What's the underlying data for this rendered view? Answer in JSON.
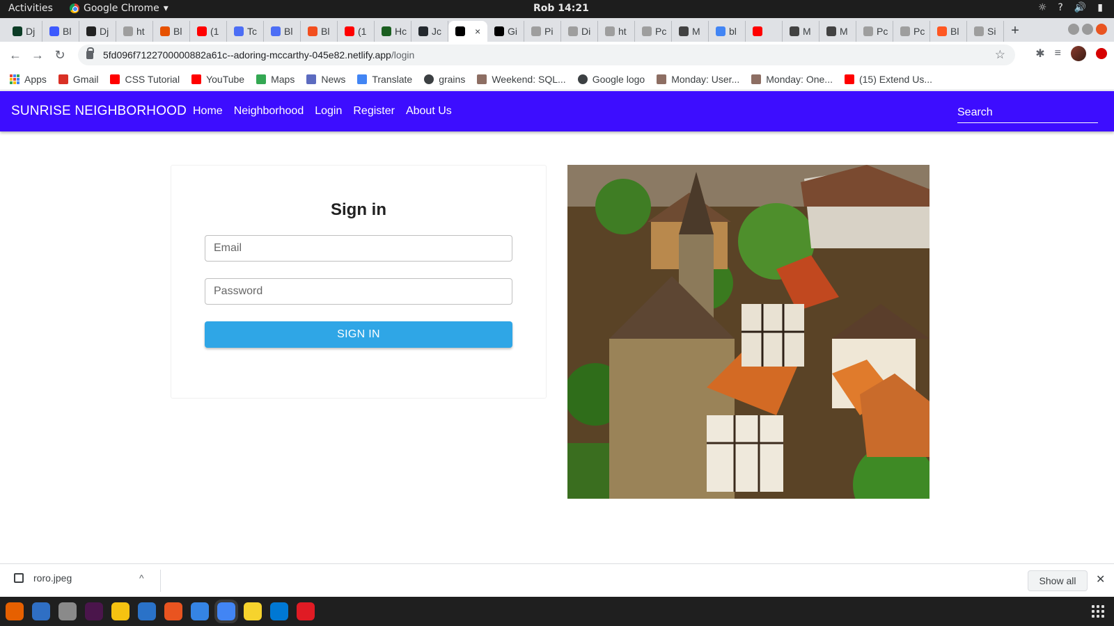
{
  "os": {
    "activities_label": "Activities",
    "app_name": "Google Chrome",
    "app_menu_arrow": "▾",
    "clock": "Rob 14:21",
    "tray_icons": [
      "weather-icon",
      "help-icon",
      "volume-icon",
      "battery-icon"
    ],
    "tray_glyphs": [
      "☼",
      "?",
      "🔊",
      "▮"
    ]
  },
  "tabs": [
    {
      "title": "Dj",
      "color": "#0c3c26"
    },
    {
      "title": "Bl",
      "color": "#3d5afe"
    },
    {
      "title": "Dj",
      "color": "#222222"
    },
    {
      "title": "ht",
      "color": "#9e9e9e"
    },
    {
      "title": "Bl",
      "color": "#e65100"
    },
    {
      "title": "(1",
      "color": "#ff0000"
    },
    {
      "title": "Tc",
      "color": "#4c6ef5"
    },
    {
      "title": "Bl",
      "color": "#4c6ef5"
    },
    {
      "title": "Bl",
      "color": "#f24e1e"
    },
    {
      "title": "(1",
      "color": "#ff0000"
    },
    {
      "title": "Hc",
      "color": "#1b5e20"
    },
    {
      "title": "Jc",
      "color": "#24292e"
    },
    {
      "title": "",
      "color": "#000000",
      "active": true,
      "close": "×"
    },
    {
      "title": "Gi",
      "color": "#000000"
    },
    {
      "title": "Pi",
      "color": "#9e9e9e"
    },
    {
      "title": "Di",
      "color": "#9e9e9e"
    },
    {
      "title": "ht",
      "color": "#9e9e9e"
    },
    {
      "title": "Pc",
      "color": "#9e9e9e"
    },
    {
      "title": "M",
      "color": "#424242"
    },
    {
      "title": "bl",
      "color": "#4285f4"
    },
    {
      "title": "",
      "color": "#ff0000"
    },
    {
      "title": "M",
      "color": "#424242"
    },
    {
      "title": "M",
      "color": "#424242"
    },
    {
      "title": "Pc",
      "color": "#9e9e9e"
    },
    {
      "title": "Pc",
      "color": "#9e9e9e"
    },
    {
      "title": "Bl",
      "color": "#ff5722"
    },
    {
      "title": "Si",
      "color": "#9e9e9e"
    }
  ],
  "newtab_glyph": "+",
  "toolbar": {
    "back": "←",
    "forward": "→",
    "reload": "↻",
    "url_host": "5fd096f7122700000882a61c--adoring-mccarthy-045e82.netlify.app",
    "url_path": "/login",
    "star": "☆",
    "extensions": "✱",
    "media": "≡"
  },
  "bookmarks": [
    {
      "label": "Apps",
      "icon": "apps-grid-icon",
      "color": "#4285f4"
    },
    {
      "label": "Gmail",
      "icon": "gmail-icon",
      "color": "#d93025"
    },
    {
      "label": "CSS Tutorial",
      "icon": "youtube-icon",
      "color": "#ff0000"
    },
    {
      "label": "YouTube",
      "icon": "youtube-icon",
      "color": "#ff0000"
    },
    {
      "label": "Maps",
      "icon": "maps-icon",
      "color": "#34a853"
    },
    {
      "label": "News",
      "icon": "news-icon",
      "color": "#5c6bc0"
    },
    {
      "label": "Translate",
      "icon": "translate-icon",
      "color": "#4285f4"
    },
    {
      "label": "grains",
      "icon": "globe-icon",
      "color": "#3c4043"
    },
    {
      "label": "Weekend: SQL...",
      "icon": "palm-icon",
      "color": "#8d6e63"
    },
    {
      "label": "Google logo",
      "icon": "globe-icon",
      "color": "#3c4043"
    },
    {
      "label": "Monday: User...",
      "icon": "palm-icon",
      "color": "#8d6e63"
    },
    {
      "label": "Monday: One...",
      "icon": "palm-icon",
      "color": "#8d6e63"
    },
    {
      "label": "(15) Extend Us...",
      "icon": "youtube-icon",
      "color": "#ff0000"
    }
  ],
  "site": {
    "brand": "SUNRISE NEIGHBORHOOD",
    "nav": [
      "Home",
      "Neighborhood",
      "Login",
      "Register",
      "About Us"
    ],
    "search_placeholder": "Search",
    "accent": "#3d0dff"
  },
  "login": {
    "title": "Sign in",
    "email_placeholder": "Email",
    "password_placeholder": "Password",
    "submit_label": "SIGN IN",
    "button_color": "#2fa6e6"
  },
  "downloads": {
    "file_name": "roro.jpeg",
    "chevron": "^",
    "show_all": "Show all",
    "close": "✕"
  },
  "dock": [
    {
      "name": "firefox-icon",
      "color": "#e66000"
    },
    {
      "name": "thunderbird-icon",
      "color": "#2f6fc4"
    },
    {
      "name": "files-icon",
      "color": "#8a8a8a"
    },
    {
      "name": "slack-icon",
      "color": "#4a154b"
    },
    {
      "name": "rhythmbox-icon",
      "color": "#f5c211"
    },
    {
      "name": "libreoffice-writer-icon",
      "color": "#2a72c8"
    },
    {
      "name": "software-icon",
      "color": "#e95420"
    },
    {
      "name": "help-icon",
      "color": "#3584e4"
    },
    {
      "name": "chrome-icon",
      "color": "#4285f4",
      "active": true
    },
    {
      "name": "text-editor-icon",
      "color": "#f6d32d"
    },
    {
      "name": "vscode-icon",
      "color": "#0078d4"
    },
    {
      "name": "document-viewer-icon",
      "color": "#e01b24"
    }
  ]
}
